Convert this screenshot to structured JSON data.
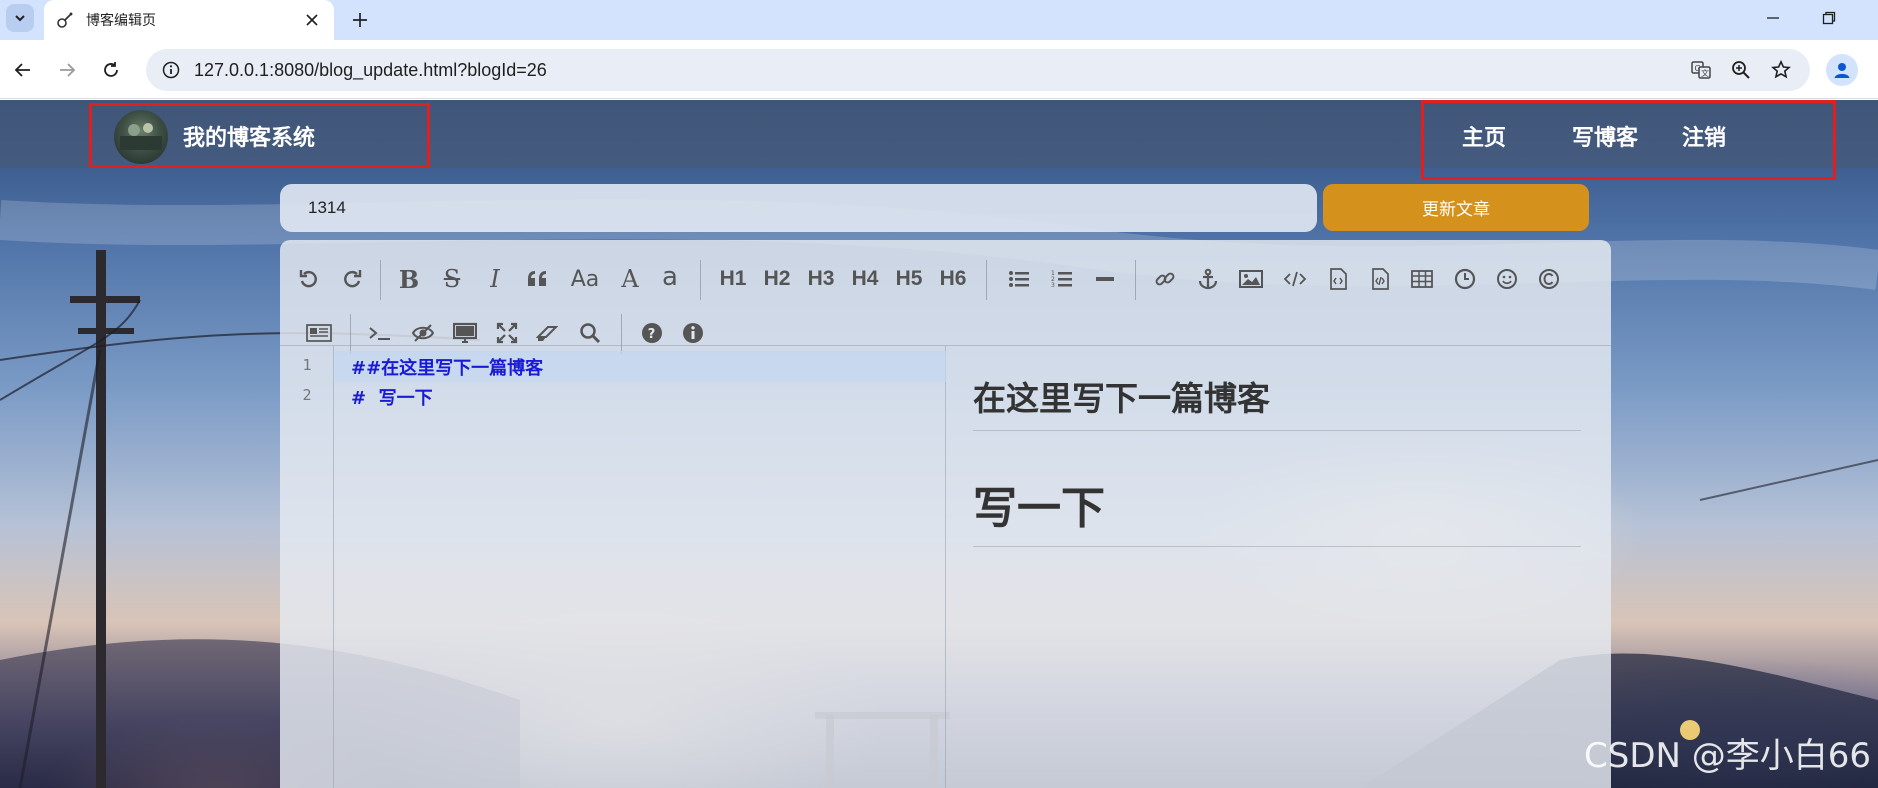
{
  "browser": {
    "tab_title": "博客编辑页",
    "url": "127.0.0.1:8080/blog_update.html?blogId=26"
  },
  "navbar": {
    "brand": "我的博客系统",
    "links": [
      "主页",
      "写博客",
      "注销"
    ]
  },
  "editor": {
    "title_value": "1314",
    "submit_label": "更新文章",
    "toolbar_row1": [
      "undo-icon",
      "redo-icon",
      "bold-icon",
      "strikethrough-icon",
      "italic-icon",
      "quote-icon",
      "uppercase-icon",
      "uppercase-first-icon",
      "lowercase-icon",
      "H1",
      "H2",
      "H3",
      "H4",
      "H5",
      "H6",
      "bullet-list-icon",
      "ordered-list-icon",
      "horizontal-rule-icon",
      "link-icon",
      "anchor-icon",
      "image-icon",
      "code-icon",
      "code-block-icon",
      "preformatted-icon",
      "table-icon",
      "datetime-icon",
      "emoji-icon",
      "html-entities-icon"
    ],
    "toolbar_row2": [
      "page-break-icon",
      "terminal-icon",
      "watch-toggle-icon",
      "preview-icon",
      "fullscreen-icon",
      "clear-icon",
      "search-icon",
      "help-icon",
      "info-icon"
    ],
    "line_numbers": [
      "1",
      "2"
    ],
    "source_lines": [
      "##在这里写下一篇博客",
      "#  写一下"
    ],
    "preview": {
      "h2": "在这里写下一篇博客",
      "h1": "写一下"
    }
  },
  "watermark": "CSDN @李小白66",
  "colors": {
    "accent_button": "#d4921d",
    "highlight_border": "#e02020",
    "code_text": "#1a1ad6"
  }
}
